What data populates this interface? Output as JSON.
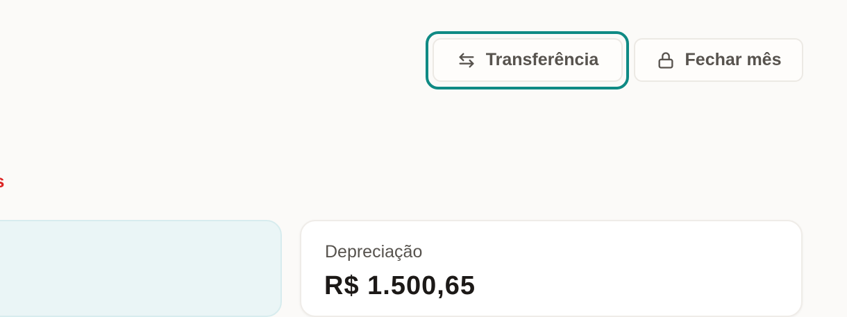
{
  "header": {
    "transfer_label": "Transferência",
    "close_month_label": "Fechar mês"
  },
  "alert_fragment": "s",
  "cards": [
    {
      "label": "",
      "value": ""
    },
    {
      "label": "Depreciação",
      "value": "R$ 1.500,65"
    }
  ],
  "colors": {
    "accent": "#0f8a84",
    "danger": "#dc2626",
    "background": "#fbfaf8"
  },
  "icons": {
    "transfer": "arrows-left-right-icon",
    "close_month": "lock-icon"
  }
}
